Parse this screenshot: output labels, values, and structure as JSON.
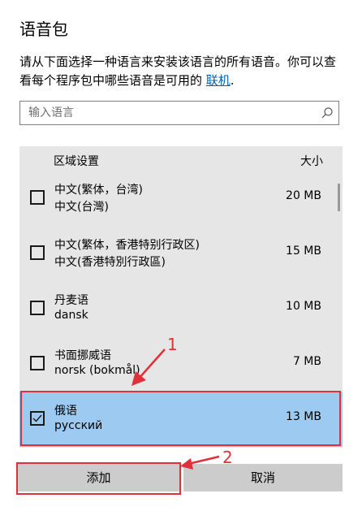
{
  "page": {
    "title": "语音包",
    "description": "请从下面选择一种语言来安装该语言的所有语音。你可以查看每个程序包中哪些语音是可用的 ",
    "link_label": "联机",
    "description_tail": "."
  },
  "search": {
    "placeholder": "输入语言",
    "icon": "search-icon"
  },
  "list": {
    "header_region": "区域设置",
    "header_size": "大小",
    "rows": [
      {
        "name": "中文(繁体，台湾)",
        "native": "中文(台灣)",
        "size": "20 MB",
        "checked": false
      },
      {
        "name": "中文(繁体，香港特别行政区)",
        "native": "中文(香港特別行政區)",
        "size": "15 MB",
        "checked": false
      },
      {
        "name": "丹麦语",
        "native": "dansk",
        "size": "10 MB",
        "checked": false
      },
      {
        "name": "书面挪威语",
        "native": "norsk (bokmål)",
        "size": "7 MB",
        "checked": false
      },
      {
        "name": "俄语",
        "native": "русский",
        "size": "13 MB",
        "checked": true
      }
    ]
  },
  "buttons": {
    "add": "添加",
    "cancel": "取消"
  },
  "annotations": {
    "step1": "1",
    "step2": "2",
    "color": "#e0303a"
  },
  "colors": {
    "selected_row": "#9dcaf0",
    "list_bg": "#e6e6e6",
    "link": "#0063b1"
  }
}
